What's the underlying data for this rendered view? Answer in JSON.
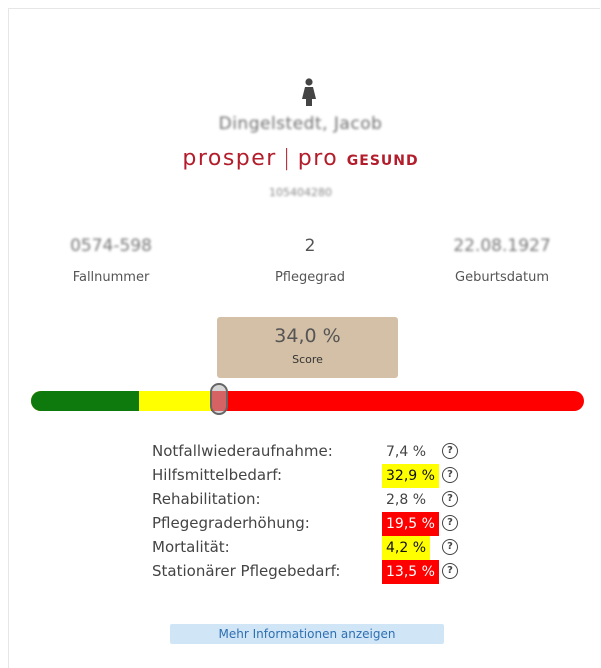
{
  "patient": {
    "name": "Dingelstedt, Jacob",
    "brand": {
      "part1": "prosper",
      "separator": "|",
      "part2": "pro",
      "part3": "GESUND"
    },
    "id": "105404280"
  },
  "stats": [
    {
      "value": "0574-598",
      "label": "Fallnummer"
    },
    {
      "value": "2",
      "label": "Pflegegrad"
    },
    {
      "value": "22.08.1927",
      "label": "Geburtsdatum"
    }
  ],
  "score": {
    "value": "34,0 %",
    "label": "Score",
    "marker_fraction": 0.34
  },
  "risk_scale_colors": {
    "green": "#0e7a0d",
    "yellow": "#ffff00",
    "red": "#ff0000"
  },
  "metrics": [
    {
      "label": "Notfallwiederaufnahme:",
      "value": "7,4 %",
      "highlight": "none"
    },
    {
      "label": "Hilfsmittelbedarf:",
      "value": "32,9 %",
      "highlight": "yellow"
    },
    {
      "label": "Rehabilitation:",
      "value": "2,8 %",
      "highlight": "none"
    },
    {
      "label": "Pflegegraderhöhung:",
      "value": "19,5 %",
      "highlight": "red"
    },
    {
      "label": "Mortalität:",
      "value": "4,2 %",
      "highlight": "yellow"
    },
    {
      "label": "Stationärer Pflegebedarf:",
      "value": "13,5 %",
      "highlight": "red"
    }
  ],
  "help_icon": "question-circle-icon",
  "more_button": {
    "label": "Mehr Informationen anzeigen"
  }
}
